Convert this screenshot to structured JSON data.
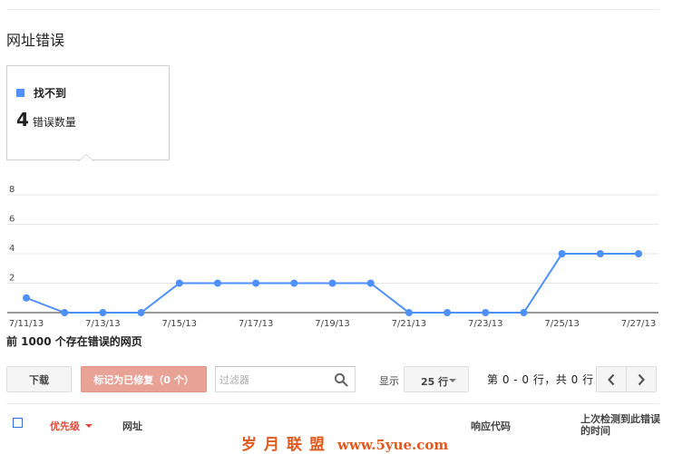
{
  "section_title": "网址错误",
  "summary_card": {
    "legend_label": "找不到",
    "legend_color": "#4d90fe",
    "count_value": "4",
    "count_label": "错误数量"
  },
  "chart_data": {
    "type": "line",
    "x": [
      "7/11/13",
      "7/12/13",
      "7/13/13",
      "7/14/13",
      "7/15/13",
      "7/16/13",
      "7/17/13",
      "7/18/13",
      "7/19/13",
      "7/20/13",
      "7/21/13",
      "7/22/13",
      "7/23/13",
      "7/24/13",
      "7/25/13",
      "7/26/13",
      "7/27/13"
    ],
    "xtick_labels": [
      "7/11/13",
      "7/13/13",
      "7/15/13",
      "7/17/13",
      "7/19/13",
      "7/21/13",
      "7/23/13",
      "7/25/13",
      "7/27/13"
    ],
    "series": [
      {
        "name": "找不到",
        "color": "#4d90fe",
        "values": [
          1,
          0,
          0,
          0,
          2,
          2,
          2,
          2,
          2,
          2,
          0,
          0,
          0,
          0,
          4,
          4,
          4
        ]
      }
    ],
    "yticks": [
      2,
      4,
      6,
      8
    ],
    "ylim": [
      0,
      8
    ],
    "grid": true,
    "title": "",
    "xlabel": "",
    "ylabel": ""
  },
  "table": {
    "caption": "前 1000 个存在错误的网页",
    "columns": {
      "priority": "优先级",
      "url": "网址",
      "response_code": "响应代码",
      "last_checked": "上次检测到此错误的时间"
    }
  },
  "toolbar": {
    "download_label": "下载",
    "mark_fixed_label": "标记为已修复（0 个）",
    "filter_placeholder": "过滤器",
    "show_label": "显示",
    "rows_value": "25 行",
    "pager_text": "第 0 - 0 行，共 0 行"
  },
  "icons": {
    "search": "search-icon",
    "prev": "chevron-left-icon",
    "next": "chevron-right-icon",
    "sort": "caret-down-icon"
  },
  "watermark": {
    "text_cn": "岁月联盟",
    "text_url": "www.5yue.com"
  }
}
